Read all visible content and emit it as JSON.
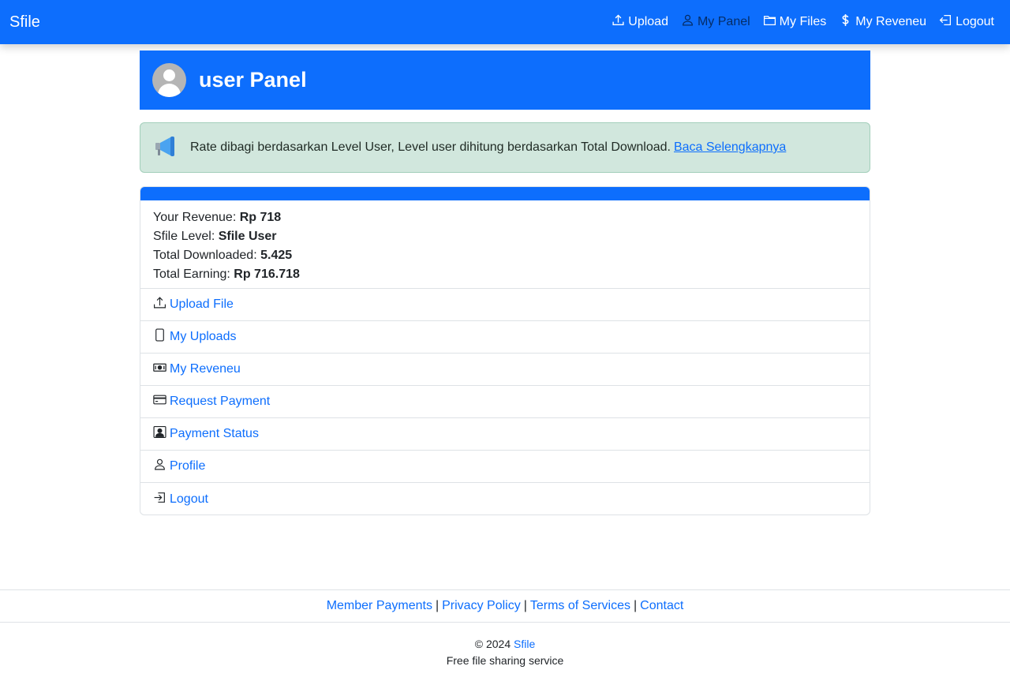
{
  "navbar": {
    "brand": "Sfile",
    "items": [
      {
        "label": "Upload",
        "icon": "upload-icon"
      },
      {
        "label": "My Panel",
        "icon": "person-icon"
      },
      {
        "label": "My Files",
        "icon": "folder-icon"
      },
      {
        "label": "My Reveneu",
        "icon": "dollar-icon"
      },
      {
        "label": "Logout",
        "icon": "logout-icon"
      }
    ]
  },
  "panel": {
    "title": "user Panel",
    "avatar_icon": "avatar-icon"
  },
  "alert": {
    "icon": "megaphone-icon",
    "message": "Rate dibagi berdasarkan Level User, Level user dihitung berdasarkan Total Download.",
    "link_text": "Baca Selengkapnya"
  },
  "stats": {
    "revenue_label": "Your Revenue: ",
    "revenue_value": "Rp 718",
    "level_label": "Sfile Level: ",
    "level_value": "Sfile User",
    "downloaded_label": "Total Downloaded: ",
    "downloaded_value": "5.425",
    "earning_label": "Total Earning: ",
    "earning_value": "Rp 716.718"
  },
  "menu": [
    {
      "label": "Upload File",
      "icon": "upload-icon"
    },
    {
      "label": "My Uploads",
      "icon": "phone-icon"
    },
    {
      "label": "My Reveneu",
      "icon": "cash-icon"
    },
    {
      "label": "Request Payment",
      "icon": "credit-card-icon"
    },
    {
      "label": "Payment Status",
      "icon": "person-badge-icon"
    },
    {
      "label": "Profile",
      "icon": "person-icon"
    },
    {
      "label": "Logout",
      "icon": "login-icon"
    }
  ],
  "footer": {
    "links": [
      "Member Payments",
      "Privacy Policy",
      "Terms of Services",
      "Contact"
    ],
    "separator": "|",
    "copyright_prefix": "© 2024",
    "copyright_brand": "Sfile",
    "tagline": "Free file sharing service"
  },
  "colors": {
    "primary": "#0d6efd",
    "alert_bg": "#d1e7dd",
    "avatar_bg": "#b5b5b5"
  }
}
